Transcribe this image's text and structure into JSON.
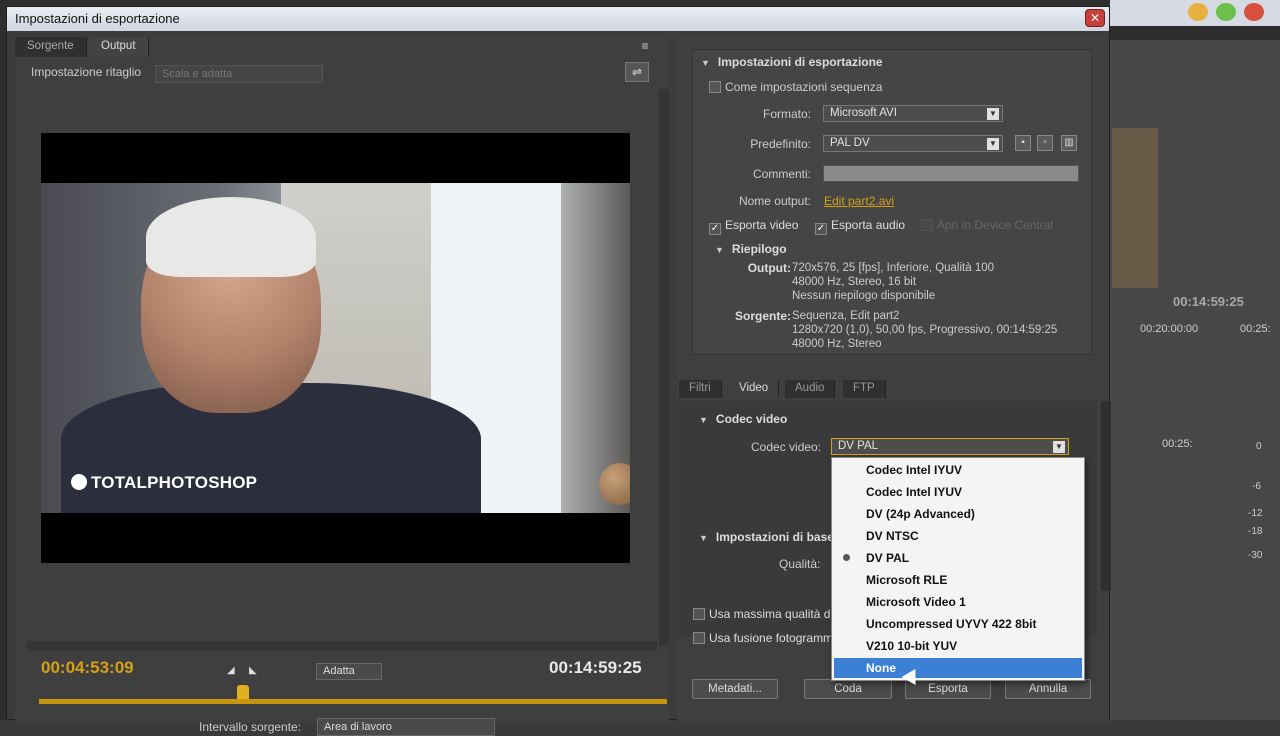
{
  "dialog": {
    "title": "Impostazioni di esportazione",
    "close_glyph": "✕"
  },
  "left_tabs": [
    "Sorgente",
    "Output"
  ],
  "crop": {
    "label": "Impostazione ritaglio",
    "value": "Scala e adatta"
  },
  "preview": {
    "watermark": "TOTALPHOTOSHOP"
  },
  "timeline": {
    "current_tc": "00:04:53:09",
    "total_tc": "00:14:59:25",
    "fit_value": "Adatta",
    "range_label": "Intervallo sorgente:",
    "range_value": "Area di lavoro"
  },
  "export": {
    "heading": "Impostazioni di esportazione",
    "match_sequence": "Come impostazioni sequenza",
    "format_label": "Formato:",
    "format_value": "Microsoft AVI",
    "preset_label": "Predefinito:",
    "preset_value": "PAL DV",
    "comments_label": "Commenti:",
    "output_name_label": "Nome output:",
    "output_name_value": "Edit part2.avi",
    "export_video": "Esporta video",
    "export_audio": "Esporta audio",
    "device_central": "Apri in Device Central",
    "summary_heading": "Riepilogo",
    "output_label": "Output:",
    "output_lines": [
      "720x576, 25 [fps], Inferiore, Qualità 100",
      "48000 Hz, Stereo, 16 bit",
      "Nessun riepilogo disponibile"
    ],
    "source_label": "Sorgente:",
    "source_lines": [
      "Sequenza, Edit part2",
      "1280x720 (1,0), 50,00 fps, Progressivo, 00:14:59:25",
      "48000 Hz, Stereo"
    ]
  },
  "bottom_tabs": [
    "Filtri",
    "Video",
    "Audio",
    "FTP"
  ],
  "codec": {
    "heading": "Codec video",
    "label": "Codec video:",
    "value": "DV PAL",
    "basic_heading": "Impostazioni di base",
    "quality_label": "Qualità:",
    "options": [
      "Codec Intel IYUV",
      "Codec Intel IYUV",
      "DV (24p Advanced)",
      "DV NTSC",
      "DV PAL",
      "Microsoft RLE",
      "Microsoft Video 1",
      "Uncompressed UYVY 422 8bit",
      "V210 10-bit YUV",
      "None"
    ],
    "checked_index": 4,
    "highlighted_index": 9
  },
  "options": {
    "max_quality": "Usa massima qualità di",
    "frame_blend": "Usa fusione fotogramm"
  },
  "footer": {
    "metadata": "Metadati...",
    "queue": "Coda",
    "export": "Esporta",
    "cancel": "Annulla"
  },
  "background": {
    "timecode": "00:14:59:25",
    "time2": "00:20:00:00",
    "time3": "00:25:",
    "time4": "00:25:",
    "meter_vals": [
      "0",
      "-6",
      "-12",
      "-18",
      "-30"
    ]
  }
}
